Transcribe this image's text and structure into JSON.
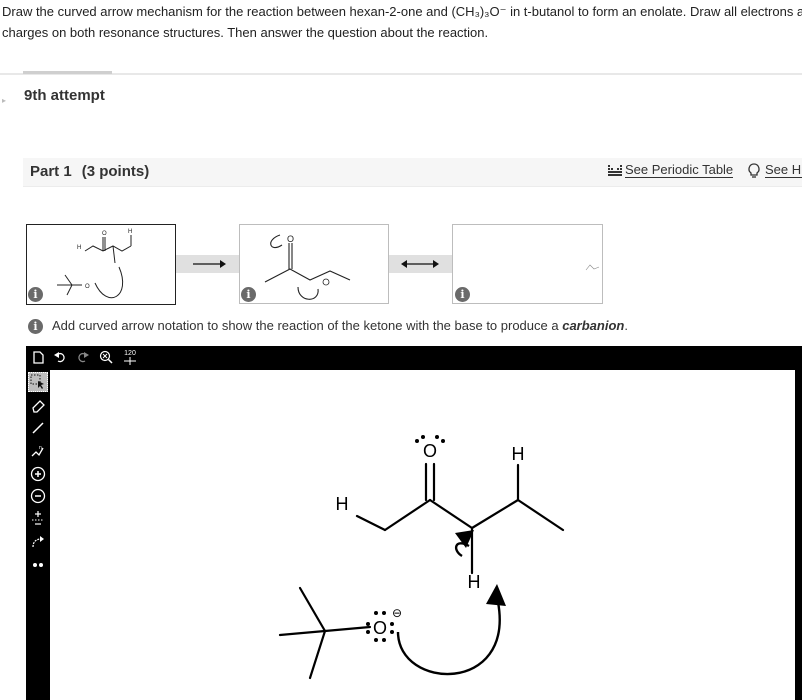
{
  "question": {
    "line1": "Draw the curved arrow mechanism for the reaction between hexan-2-one and (CH₃)₃O⁻ in t-butanol to form an enolate. Draw all electrons and",
    "line2": "charges on both resonance structures. Then answer the question about the reaction."
  },
  "attempt": {
    "label": "9th attempt"
  },
  "part": {
    "title": "Part 1",
    "points": "(3 points)",
    "periodic_table_label": "See Periodic Table",
    "hint_label": "See Hi"
  },
  "instruction": {
    "prefix": "Add curved arrow notation to show the reaction of the ketone with the base to produce a ",
    "emphasis": "carbanion",
    "suffix": "."
  },
  "info_glyph": "i",
  "toolbar": {
    "new_icon": "document-icon",
    "undo_icon": "undo-icon",
    "redo_icon": "redo-icon",
    "zoom_icon": "zoom-icon",
    "template_label": "120"
  },
  "tools": [
    {
      "name": "select-tool",
      "icon": "selection-arrow-icon",
      "active": true
    },
    {
      "name": "eraser-tool",
      "icon": "eraser-icon"
    },
    {
      "name": "bond-tool",
      "icon": "single-bond-icon"
    },
    {
      "name": "chain-tool",
      "icon": "chain-icon"
    },
    {
      "name": "positive-charge-tool",
      "icon": "plus-circle-icon"
    },
    {
      "name": "negative-charge-tool",
      "icon": "minus-circle-icon"
    },
    {
      "name": "charge-tool",
      "icon": "plus-minus-icon"
    },
    {
      "name": "curved-arrow-tool",
      "icon": "curved-arrow-icon"
    },
    {
      "name": "lone-pair-tool",
      "icon": "lone-pair-icon"
    }
  ],
  "molecule": {
    "oxygen_label": "O",
    "hydrogen_top_label": "H",
    "hydrogen_left_label": "H",
    "hydrogen_alpha_label": "H",
    "base_oxygen_label": "O",
    "charge_symbol": "⊖"
  },
  "colors": {
    "toolbar": "#000000",
    "info_icon": "#6a6a6a",
    "connector": "#e0e0e0"
  }
}
